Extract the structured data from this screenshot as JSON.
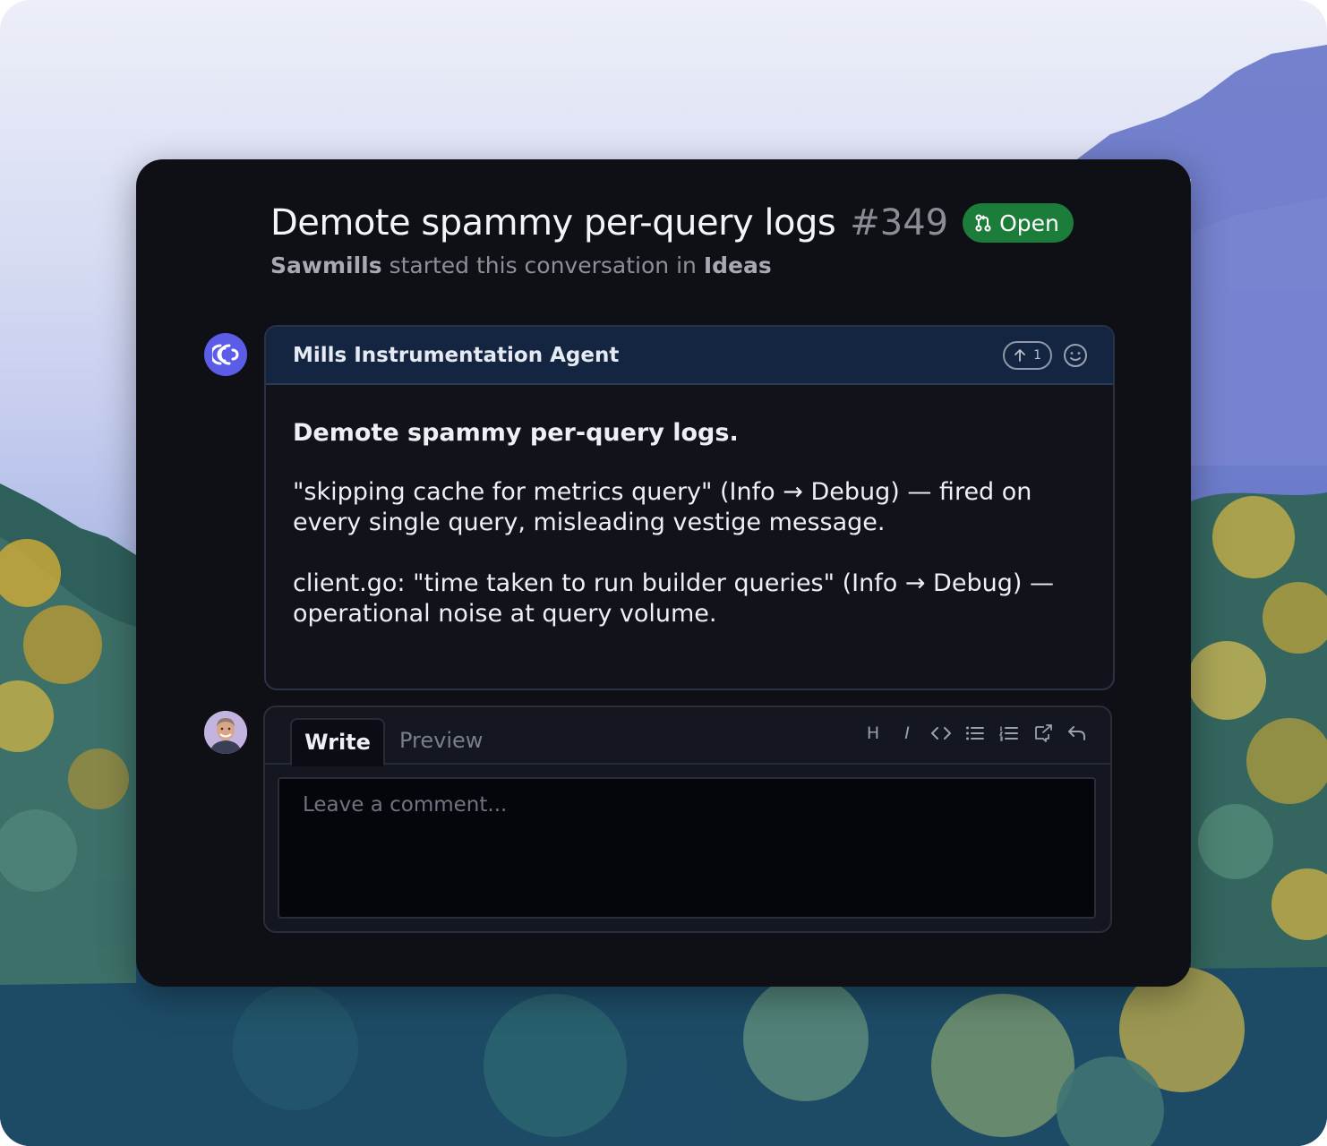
{
  "issue": {
    "title": "Demote spammy per-query logs",
    "number": "#349",
    "status": "Open",
    "author": "Sawmills",
    "started_text": "started this conversation in",
    "category": "Ideas"
  },
  "comment": {
    "author": "Mills Instrumentation Agent",
    "upvote_count": "1",
    "body_title": "Demote spammy per-query logs.",
    "paragraphs": [
      "\"skipping cache for metrics query\" (Info → Debug) — fired on every single query, misleading vestige message.",
      "client.go: \"time taken to run builder queries\" (Info → Debug) — operational noise at query volume."
    ]
  },
  "editor": {
    "tab_write": "Write",
    "tab_preview": "Preview",
    "placeholder": "Leave a comment...",
    "toolbar": {
      "heading": "H",
      "italic": "I"
    },
    "toolbar_icons": [
      "heading-icon",
      "italic-icon",
      "code-icon",
      "bullet-list-icon",
      "numbered-list-icon",
      "link-icon",
      "undo-icon"
    ]
  },
  "colors": {
    "panel": "#0f0f16",
    "status_green": "#1c7d3a",
    "agent_avatar": "#5b5de8",
    "comment_header": "#132540"
  }
}
